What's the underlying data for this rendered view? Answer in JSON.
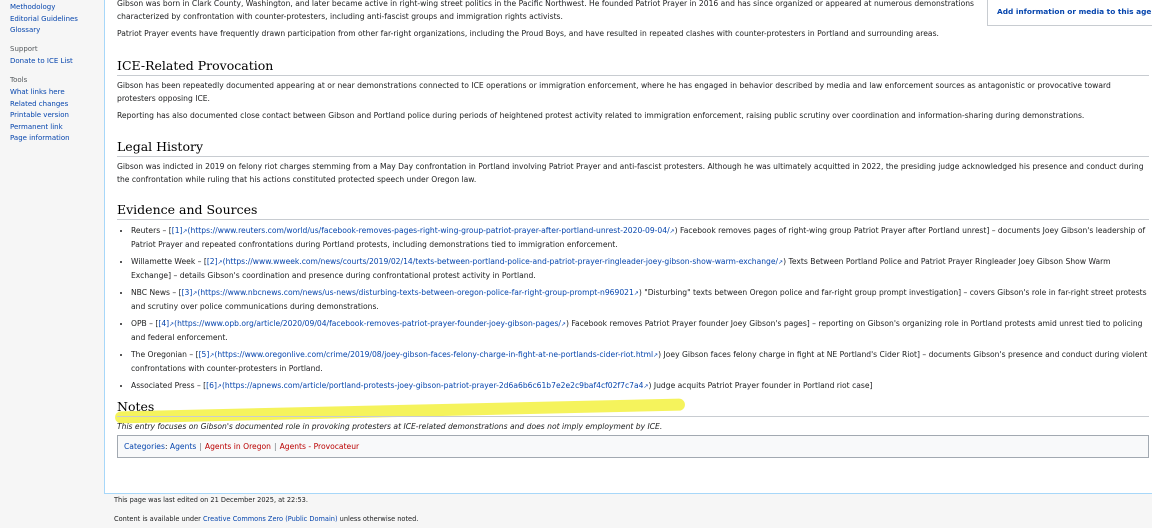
{
  "sidebar": {
    "nav_items": [
      "Methodology",
      "Editorial Guidelines",
      "Glossary"
    ],
    "support_heading": "Support",
    "support_items": [
      "Donate to ICE List"
    ],
    "tools_heading": "Tools",
    "tools_items": [
      "What links here",
      "Related changes",
      "Printable version",
      "Permanent link",
      "Page information"
    ]
  },
  "infobox": {
    "link": "Add information or media to this agent"
  },
  "intro": {
    "p1": "Gibson was born in Clark County, Washington, and later became active in right-wing street politics in the Pacific Northwest. He founded Patriot Prayer in 2016 and has since organized or appeared at numerous demonstrations characterized by confrontation with counter-protesters, including anti-fascist groups and immigration rights activists.",
    "p2": "Patriot Prayer events have frequently drawn participation from other far-right organizations, including the Proud Boys, and have resulted in repeated clashes with counter-protesters in Portland and surrounding areas."
  },
  "sections": {
    "ice": {
      "heading": "ICE-Related Provocation",
      "p1": "Gibson has been repeatedly documented appearing at or near demonstrations connected to ICE operations or immigration enforcement, where he has engaged in behavior described by media and law enforcement sources as antagonistic or provocative toward protesters opposing ICE.",
      "p2": "Reporting has also documented close contact between Gibson and Portland police during periods of heightened protest activity related to immigration enforcement, raising public scrutiny over coordination and information-sharing during demonstrations."
    },
    "legal": {
      "heading": "Legal History",
      "p1": "Gibson was indicted in 2019 on felony riot charges stemming from a May Day confrontation in Portland involving Patriot Prayer and anti-fascist protesters. Although he was ultimately acquitted in 2022, the presiding judge acknowledged his presence and conduct during the confrontation while ruling that his actions constituted protected speech under Oregon law."
    },
    "evidence": {
      "heading": "Evidence and Sources",
      "items": [
        {
          "source": "Reuters – [",
          "ref": "[1]",
          "url": "(https://www.reuters.com/world/us/facebook-removes-pages-right-wing-group-patriot-prayer-after-portland-unrest-2020-09-04/",
          "desc": ") Facebook removes pages of right-wing group Patriot Prayer after Portland unrest] – documents Joey Gibson's leadership of Patriot Prayer and repeated confrontations during Portland protests, including demonstrations tied to immigration enforcement."
        },
        {
          "source": "Willamette Week – [",
          "ref": "[2]",
          "url": "(https://www.wweek.com/news/courts/2019/02/14/texts-between-portland-police-and-patriot-prayer-ringleader-joey-gibson-show-warm-exchange/",
          "desc": ") Texts Between Portland Police and Patriot Prayer Ringleader Joey Gibson Show Warm Exchange] – details Gibson's coordination and presence during confrontational protest activity in Portland."
        },
        {
          "source": "NBC News – [",
          "ref": "[3]",
          "url": "(https://www.nbcnews.com/news/us-news/disturbing-texts-between-oregon-police-far-right-group-prompt-n969021",
          "desc": ") \"Disturbing\" texts between Oregon police and far-right group prompt investigation] – covers Gibson's role in far-right street protests and scrutiny over police communications during demonstrations."
        },
        {
          "source": "OPB – [",
          "ref": "[4]",
          "url": "(https://www.opb.org/article/2020/09/04/facebook-removes-patriot-prayer-founder-joey-gibson-pages/",
          "desc": ") Facebook removes Patriot Prayer founder Joey Gibson's pages] – reporting on Gibson's organizing role in Portland protests amid unrest tied to policing and federal enforcement."
        },
        {
          "source": "The Oregonian – [",
          "ref": "[5]",
          "url": "(https://www.oregonlive.com/crime/2019/08/joey-gibson-faces-felony-charge-in-fight-at-ne-portlands-cider-riot.html",
          "desc": ") Joey Gibson faces felony charge in fight at NE Portland's Cider Riot] – documents Gibson's presence and conduct during violent confrontations with counter-protesters in Portland."
        },
        {
          "source": "Associated Press – [",
          "ref": "[6]",
          "url": "(https://apnews.com/article/portland-protests-joey-gibson-patriot-prayer-2d6a6b6c61b7e2e2c9baf4cf02f7c7a4",
          "desc": ") Judge acquits Patriot Prayer founder in Portland riot case]"
        }
      ]
    },
    "notes": {
      "heading": "Notes",
      "text": "This entry focuses on Gibson's documented role in provoking protesters at ICE-related demonstrations and does not imply employment by ICE."
    }
  },
  "categories": {
    "label": "Categories",
    "items": [
      "Agents",
      "Agents in Oregon",
      "Agents - Provocateur"
    ],
    "colors": [
      "#0645ad",
      "#ba0000",
      "#ba0000"
    ]
  },
  "footer": {
    "last_edited": "This page was last edited on 21 December 2025, at 22:53.",
    "license_prefix": "Content is available under ",
    "license_link": "Creative Commons Zero (Public Domain)",
    "license_suffix": " unless otherwise noted."
  },
  "icons": {
    "external_link": "external-link-icon"
  }
}
